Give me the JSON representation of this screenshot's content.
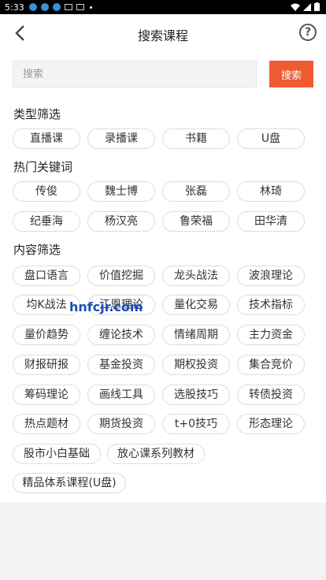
{
  "status_bar": {
    "time": "5:33"
  },
  "header": {
    "title": "搜索课程",
    "help_symbol": "?"
  },
  "search": {
    "placeholder": "搜索",
    "value": "",
    "button_label": "搜索"
  },
  "sections": {
    "type_filter": {
      "title": "类型筛选",
      "tags": [
        "直播课",
        "录播课",
        "书籍",
        "U盘"
      ]
    },
    "hot_keywords": {
      "title": "热门关键词",
      "tags": [
        "传俊",
        "魏士博",
        "张磊",
        "林琦",
        "纪垂海",
        "杨汉亮",
        "鲁荣福",
        "田华清"
      ]
    },
    "content_filter": {
      "title": "内容筛选",
      "tags": [
        "盘口语言",
        "价值挖掘",
        "龙头战法",
        "波浪理论",
        "均K战法",
        "江恩理论",
        "量化交易",
        "技术指标",
        "量价趋势",
        "缠论技术",
        "情绪周期",
        "主力资金",
        "财报研报",
        "基金投资",
        "期权投资",
        "集合竞价",
        "筹码理论",
        "画线工具",
        "选股技巧",
        "转债投资",
        "热点题材",
        "期货投资",
        "t+0技巧",
        "形态理论",
        "股市小白基础",
        "放心课系列教材",
        "精品体系课程(U盘)"
      ]
    }
  },
  "watermark": "hnfcjr.com",
  "colors": {
    "accent": "#f05a30",
    "watermark": "#1a4fb6",
    "tag_border": "#dedede"
  }
}
